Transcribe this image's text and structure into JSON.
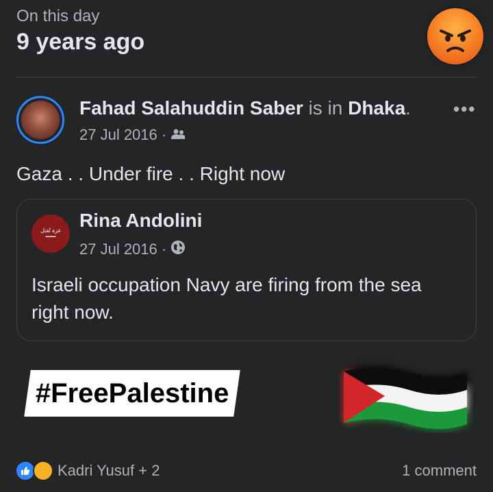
{
  "memory": {
    "label": "On this day",
    "years": "9 years ago",
    "reaction_icon": "angry-emoji-icon"
  },
  "post": {
    "author": "Fahad Salahuddin Saber",
    "verb": "is in",
    "location": "Dhaka",
    "date": "27 Jul 2016",
    "audience_icon": "friends-icon",
    "text": "Gaza . . Under fire . . Right now"
  },
  "shared_post": {
    "author": "Rina Andolini",
    "date": "27 Jul 2016",
    "audience_icon": "globe-icon",
    "text": "Israeli occupation Navy are firing from the sea right now."
  },
  "overlay": {
    "hashtag": "#FreePalestine",
    "flag_icon": "palestine-flag-icon"
  },
  "footer": {
    "reactors": "Kadri Yusuf + 2",
    "comments": "1 comment"
  },
  "colors": {
    "background": "#242526",
    "accent": "#2d88ff"
  }
}
